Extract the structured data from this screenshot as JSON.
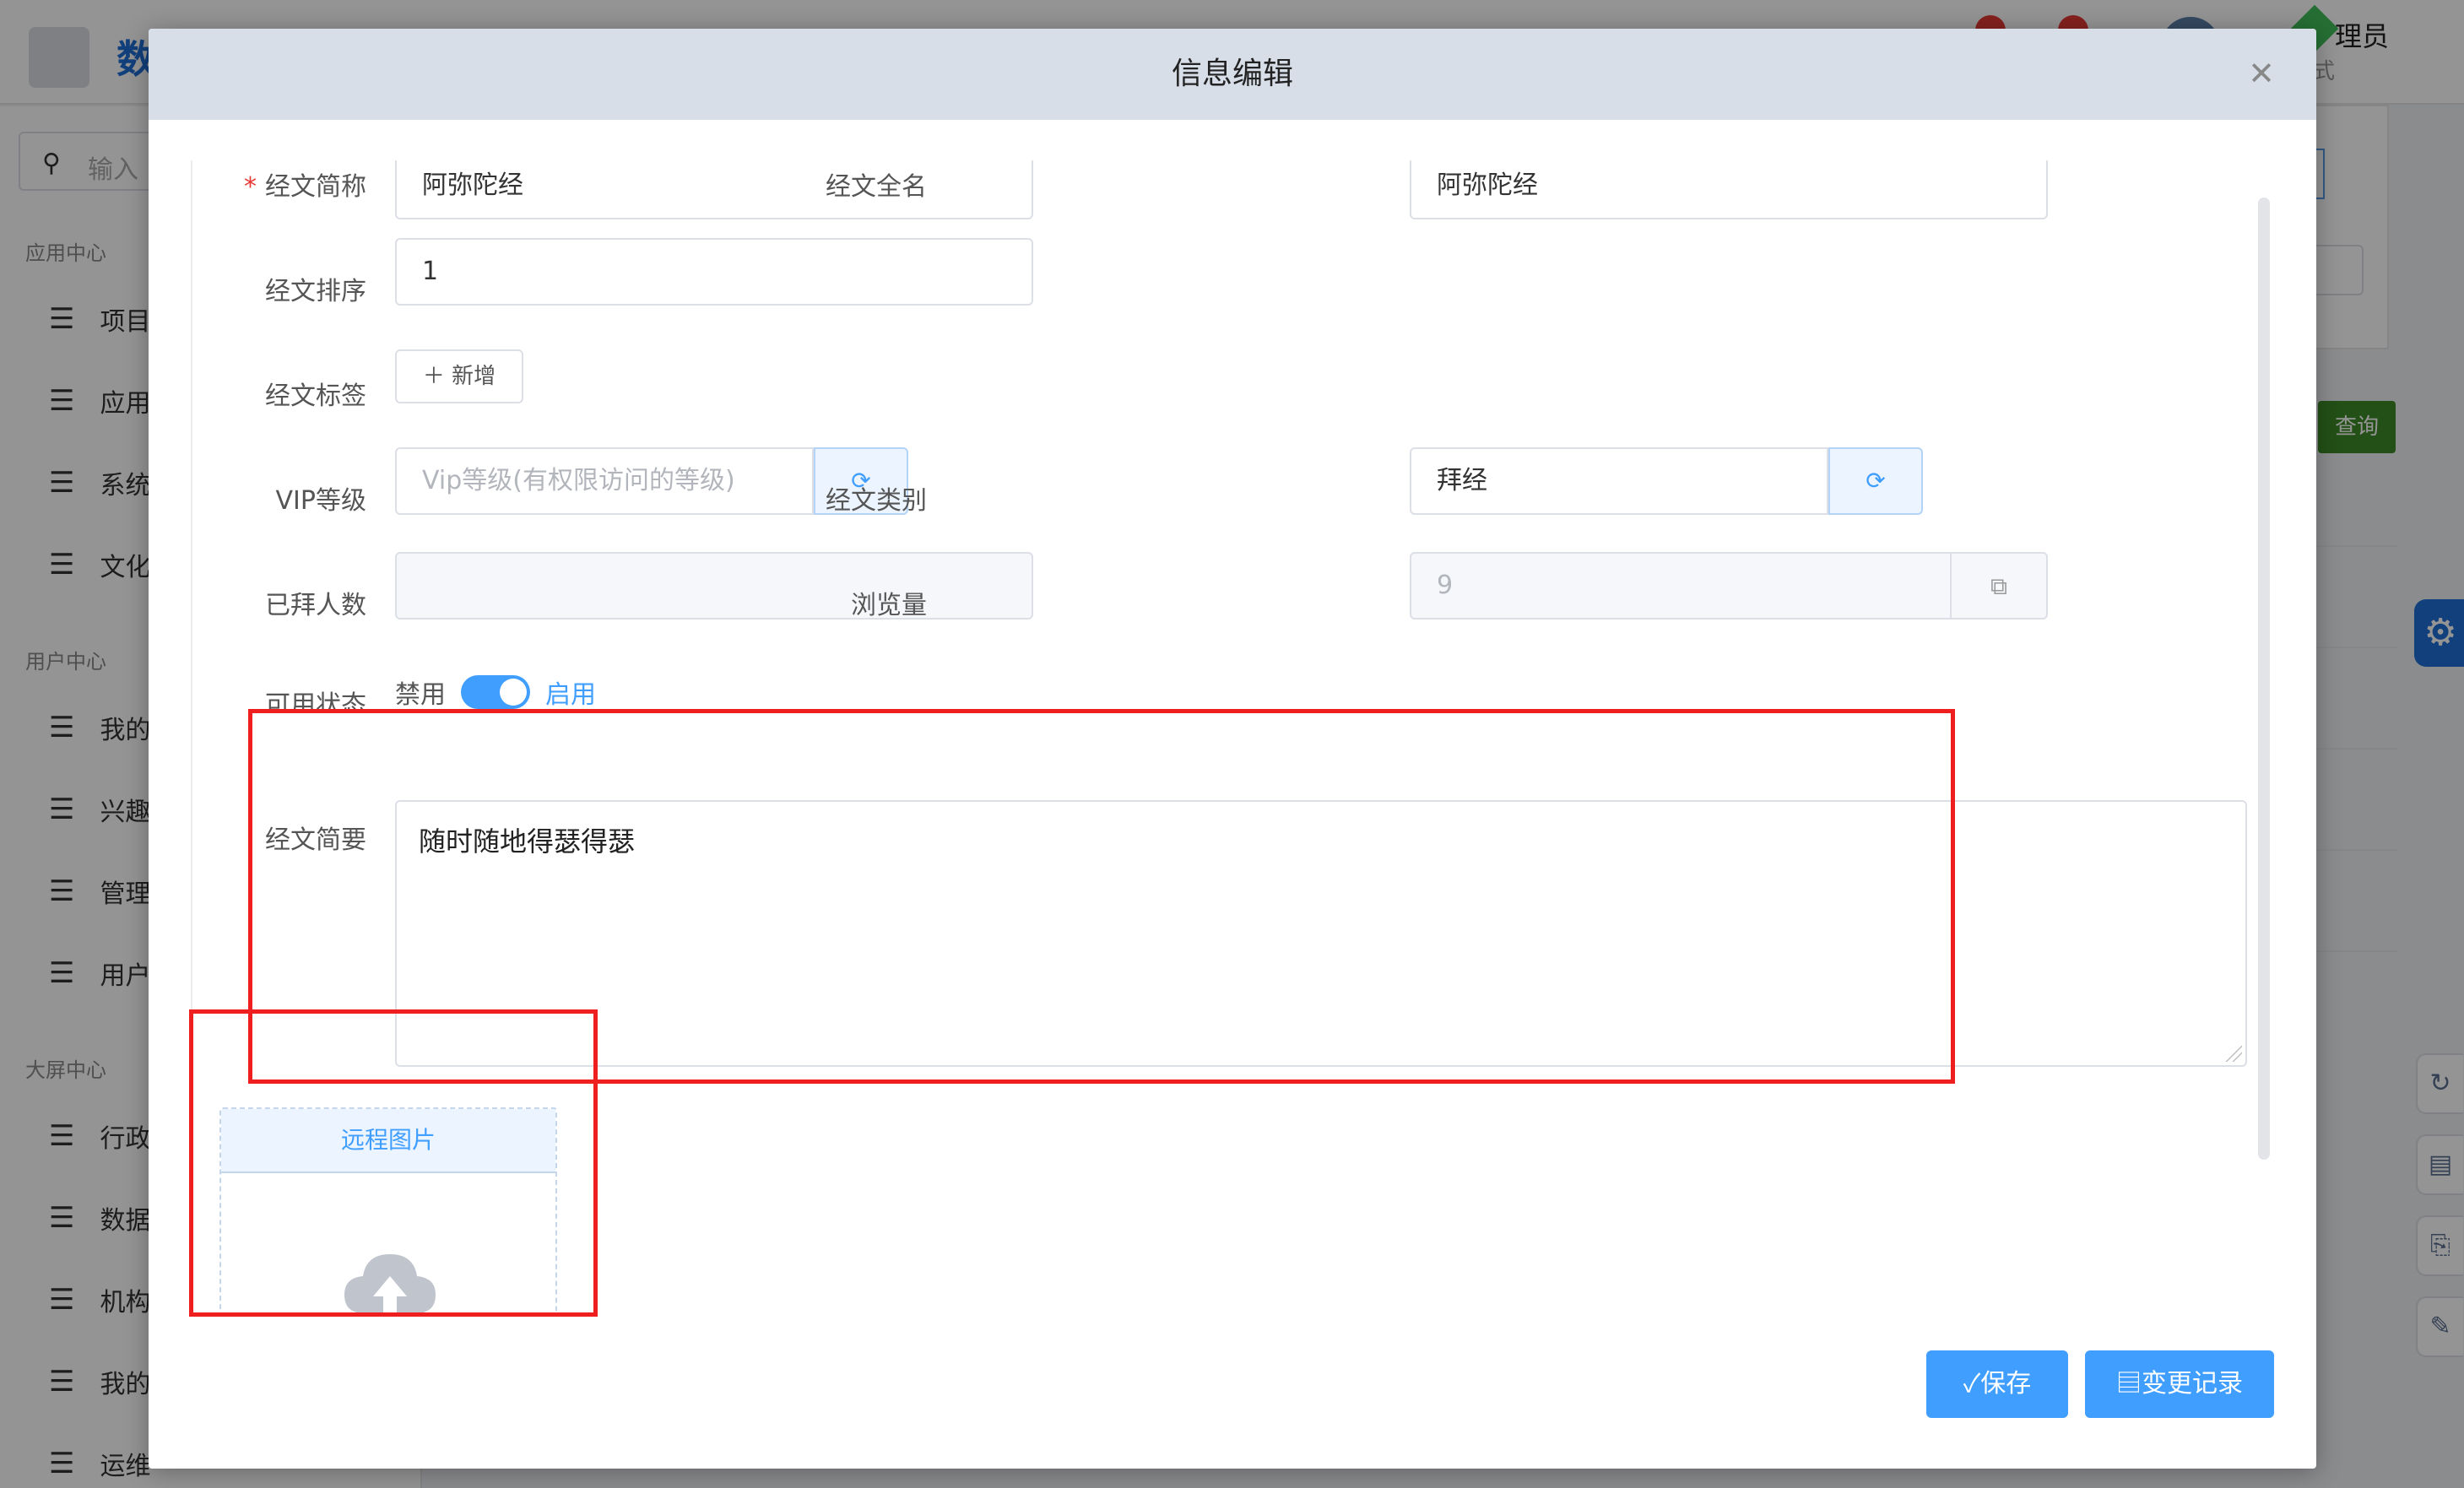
{
  "app": {
    "title_prefix": "数",
    "user_name": "理员",
    "user_sub": "式",
    "query_button": "查询"
  },
  "sidebar": {
    "search_placeholder": "输入",
    "sections": [
      {
        "label": "应用中心",
        "items": [
          "项目",
          "应用",
          "系统",
          "文化"
        ]
      },
      {
        "label": "用户中心",
        "items": [
          "我的",
          "兴趣",
          "管理",
          "用户"
        ]
      },
      {
        "label": "大屏中心",
        "items": [
          "行政",
          "数据",
          "机构",
          "我的",
          "运维"
        ]
      }
    ]
  },
  "modal": {
    "title": "信息编辑",
    "close_icon": "close-icon",
    "fields": {
      "short_name": {
        "label": "经文简称",
        "value": "阿弥陀经",
        "required": true
      },
      "full_name": {
        "label": "经文全名",
        "value": "阿弥陀经"
      },
      "sort": {
        "label": "经文排序",
        "value": "1"
      },
      "tags": {
        "label": "经文标签",
        "add_label": "新增"
      },
      "vip_level": {
        "label": "VIP等级",
        "placeholder": "Vip等级(有权限访问的等级)"
      },
      "category": {
        "label": "经文类别",
        "value": "拜经"
      },
      "worship_count": {
        "label": "已拜人数",
        "value": ""
      },
      "views": {
        "label": "浏览量",
        "value": "9"
      },
      "status": {
        "label": "可用状态",
        "off_label": "禁用",
        "on_label": "启用",
        "enabled": true
      },
      "summary": {
        "label": "经文简要",
        "value": "随时随地得瑟得瑟"
      },
      "image": {
        "tab_label": "远程图片"
      }
    },
    "buttons": {
      "save": "✓保存",
      "history": "变更记录"
    }
  },
  "colors": {
    "primary": "#409eff",
    "annotation_red": "#ef1f1f",
    "header_bg": "#d7dee8"
  }
}
